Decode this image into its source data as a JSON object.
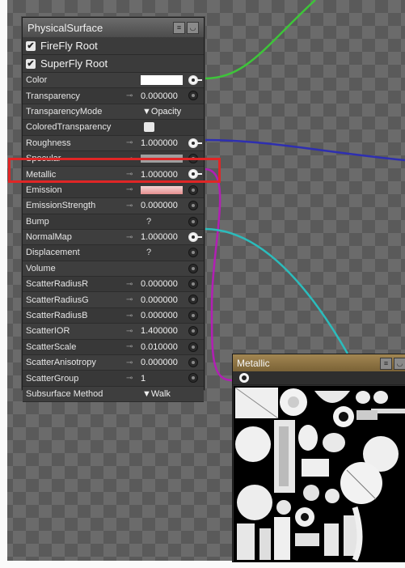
{
  "surface_node": {
    "title": "PhysicalSurface",
    "title_icons": [
      "list-icon",
      "collapse-icon"
    ],
    "roots": [
      {
        "label": "FireFly Root",
        "checked": true
      },
      {
        "label": "SuperFly Root",
        "checked": true
      }
    ],
    "params": [
      {
        "name": "Color",
        "kind": "color",
        "connected": true
      },
      {
        "name": "Transparency",
        "kind": "number",
        "link": "⊸",
        "value": "0.000000"
      },
      {
        "name": "TransparencyMode",
        "kind": "select",
        "value": "▼Opacity"
      },
      {
        "name": "ColoredTransparency",
        "kind": "checkbox"
      },
      {
        "name": "Roughness",
        "kind": "number",
        "link": "⊸",
        "value": "1.000000",
        "connected": true
      },
      {
        "name": "Specular",
        "kind": "bar",
        "link": "⊸"
      },
      {
        "name": "Metallic",
        "kind": "number",
        "link": "⊸",
        "value": "1.000000",
        "connected": true
      },
      {
        "name": "Emission",
        "kind": "redbar",
        "link": "⊸"
      },
      {
        "name": "EmissionStrength",
        "kind": "number",
        "link": "⊸",
        "value": "0.000000"
      },
      {
        "name": "Bump",
        "kind": "question",
        "value": "?"
      },
      {
        "name": "NormalMap",
        "kind": "number",
        "link": "⊸",
        "value": "1.000000",
        "connected": true
      },
      {
        "name": "Displacement",
        "kind": "question",
        "value": "?"
      },
      {
        "name": "Volume",
        "kind": "empty"
      },
      {
        "name": "ScatterRadiusR",
        "kind": "number",
        "link": "⊸",
        "value": "0.000000"
      },
      {
        "name": "ScatterRadiusG",
        "kind": "number",
        "link": "⊸",
        "value": "0.000000"
      },
      {
        "name": "ScatterRadiusB",
        "kind": "number",
        "link": "⊸",
        "value": "0.000000"
      },
      {
        "name": "ScatterIOR",
        "kind": "number",
        "link": "⊸",
        "value": "1.400000"
      },
      {
        "name": "ScatterScale",
        "kind": "number",
        "link": "⊸",
        "value": "0.010000"
      },
      {
        "name": "ScatterAnisotropy",
        "kind": "number",
        "link": "⊸",
        "value": "0.000000"
      },
      {
        "name": "ScatterGroup",
        "kind": "number",
        "link": "⊸",
        "value": "1"
      },
      {
        "name": "Subsurface Method",
        "kind": "select",
        "value": "▼Walk"
      }
    ]
  },
  "texture_node": {
    "title": "Metallic",
    "title_icons": [
      "list-icon",
      "collapse-icon"
    ]
  },
  "highlighted_param": "Metallic",
  "colors": {
    "wire_color": "#3ec43a",
    "wire_roughness": "#2e2fb0",
    "wire_metallic": "#b21fb4",
    "wire_normal": "#2bbcbc",
    "highlight": "#e02626",
    "texture_title": "#8f7445"
  }
}
